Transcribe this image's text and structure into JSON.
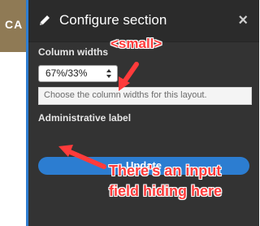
{
  "background": {
    "partial_text": "CA"
  },
  "panel": {
    "title": "Configure section",
    "close_label": "×",
    "column_widths_label": "Column widths",
    "column_widths_value": "67%/33%",
    "description": "Choose the column widths for this layout.",
    "admin_label": "Administrative label",
    "update_label": "Update"
  },
  "annotations": {
    "small_tag": "<small>",
    "hidden_note_line1": "There's an input",
    "hidden_note_line2": "field hiding here"
  },
  "colors": {
    "panel_bg": "#333333",
    "accent": "#2c7dd1",
    "annotation": "#ff3b3b",
    "brand_bg": "#8f7a55"
  }
}
